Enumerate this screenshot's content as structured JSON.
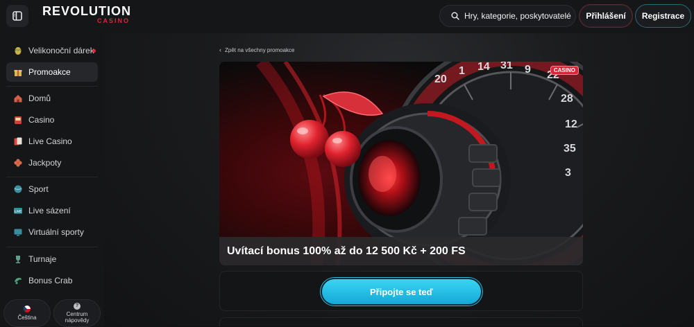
{
  "header": {
    "logo_main": "REVOLUTION",
    "logo_sub": "CASINO",
    "search_placeholder": "Hry, kategorie, poskytovatelé",
    "login_label": "Přihlášení",
    "register_label": "Registrace"
  },
  "sidebar": {
    "items": [
      {
        "label": "Velikonoční dárek",
        "icon": "easter-egg-icon"
      },
      {
        "label": "Promoakce",
        "icon": "gift-icon"
      },
      {
        "label": "Domů",
        "icon": "home-icon"
      },
      {
        "label": "Casino",
        "icon": "slot-machine-icon"
      },
      {
        "label": "Live Casino",
        "icon": "live-cards-icon"
      },
      {
        "label": "Jackpoty",
        "icon": "clover-icon"
      },
      {
        "label": "Sport",
        "icon": "sport-ball-icon"
      },
      {
        "label": "Live sázení",
        "icon": "live-tv-icon"
      },
      {
        "label": "Virtuální sporty",
        "icon": "virtual-screen-icon"
      },
      {
        "label": "Turnaje",
        "icon": "trophy-icon"
      },
      {
        "label": "Bonus Crab",
        "icon": "crab-claw-icon"
      }
    ],
    "language_label": "Čeština",
    "help_label_1": "Centrum",
    "help_label_2": "nápovědy"
  },
  "main": {
    "back_link": "Zpět na všechny promoakce",
    "badge": "CASINO",
    "promo_title": "Uvítací bonus 100% až do 12 500 Kč + 200 FS",
    "join_button": "Připojte se teď"
  },
  "colors": {
    "accent_red": "#e3243b",
    "join_button": "#22bde6",
    "background": "#111214"
  }
}
